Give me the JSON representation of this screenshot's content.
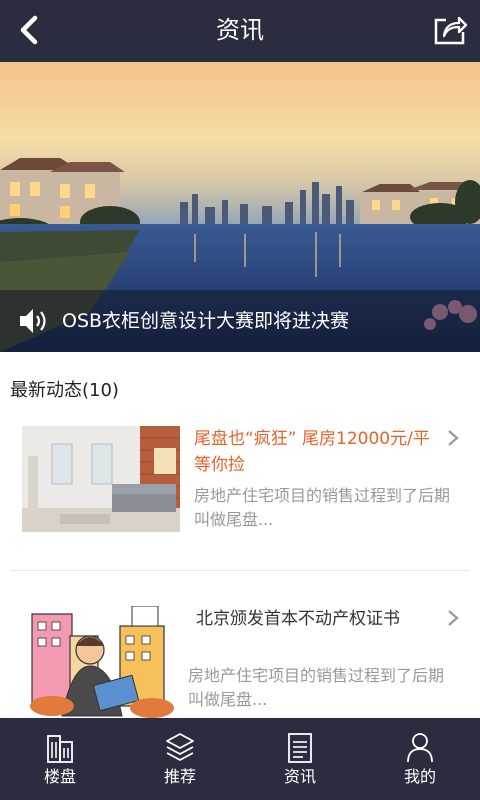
{
  "header": {
    "title": "资讯",
    "back_icon": "chevron-left-icon",
    "share_icon": "share-icon"
  },
  "banner": {
    "caption": "OSB衣柜创意设计大赛即将进决赛",
    "speaker_icon": "speaker-icon"
  },
  "section": {
    "title": "最新动态(10)"
  },
  "news": [
    {
      "title": "尾盘也“疯狂” 尾房12000元/平等你捡",
      "title_color": "#e8622a",
      "summary": "房地产住宅项目的销售过程到了后期叫做尾盘..."
    },
    {
      "title": "北京颁发首本不动产权证书",
      "title_color": "#333333",
      "summary": "房地产住宅项目的销售过程到了后期叫做尾盘..."
    }
  ],
  "tabbar": {
    "items": [
      {
        "label": "楼盘",
        "icon": "building-icon"
      },
      {
        "label": "推荐",
        "icon": "layers-icon"
      },
      {
        "label": "资讯",
        "icon": "document-icon"
      },
      {
        "label": "我的",
        "icon": "user-icon"
      }
    ]
  },
  "colors": {
    "bar": "#2a2d3f",
    "accent": "#e8622a"
  }
}
